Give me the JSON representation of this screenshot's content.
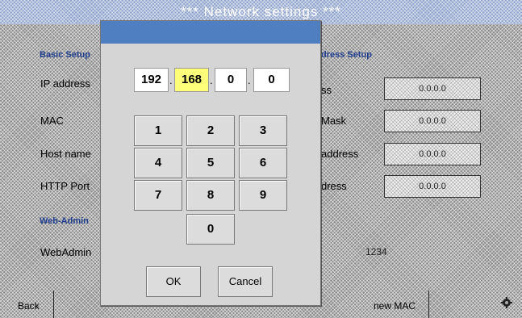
{
  "screen": {
    "title": "*** Network settings ***",
    "basic_setup_label": "Basic Setup",
    "address_setup_label": "dress Setup",
    "rows_left": [
      "IP address",
      "MAC",
      "Host name",
      "HTTP Port"
    ],
    "rows_right": [
      "ss",
      "Mask",
      "address",
      "dress"
    ],
    "values_right": [
      "0.0.0.0",
      "0.0.0.0",
      "0.0.0.0",
      "0.0.0.0"
    ],
    "webadmin_section": "Web-Admin",
    "webadmin_label": "WebAdmin",
    "webadmin_value": "1234",
    "back_label": "Back",
    "new_mac_label": "new MAC",
    "settings_icon": "gear-icon"
  },
  "dialog": {
    "ip_octets": [
      "192",
      "168",
      "0",
      "0"
    ],
    "active_octet": 1,
    "keys": [
      "1",
      "2",
      "3",
      "4",
      "5",
      "6",
      "7",
      "8",
      "9",
      "0"
    ],
    "ok_label": "OK",
    "cancel_label": "Cancel",
    "colors": {
      "title_bar": "#4f7fc0",
      "active_field": "#ffff7a"
    }
  }
}
